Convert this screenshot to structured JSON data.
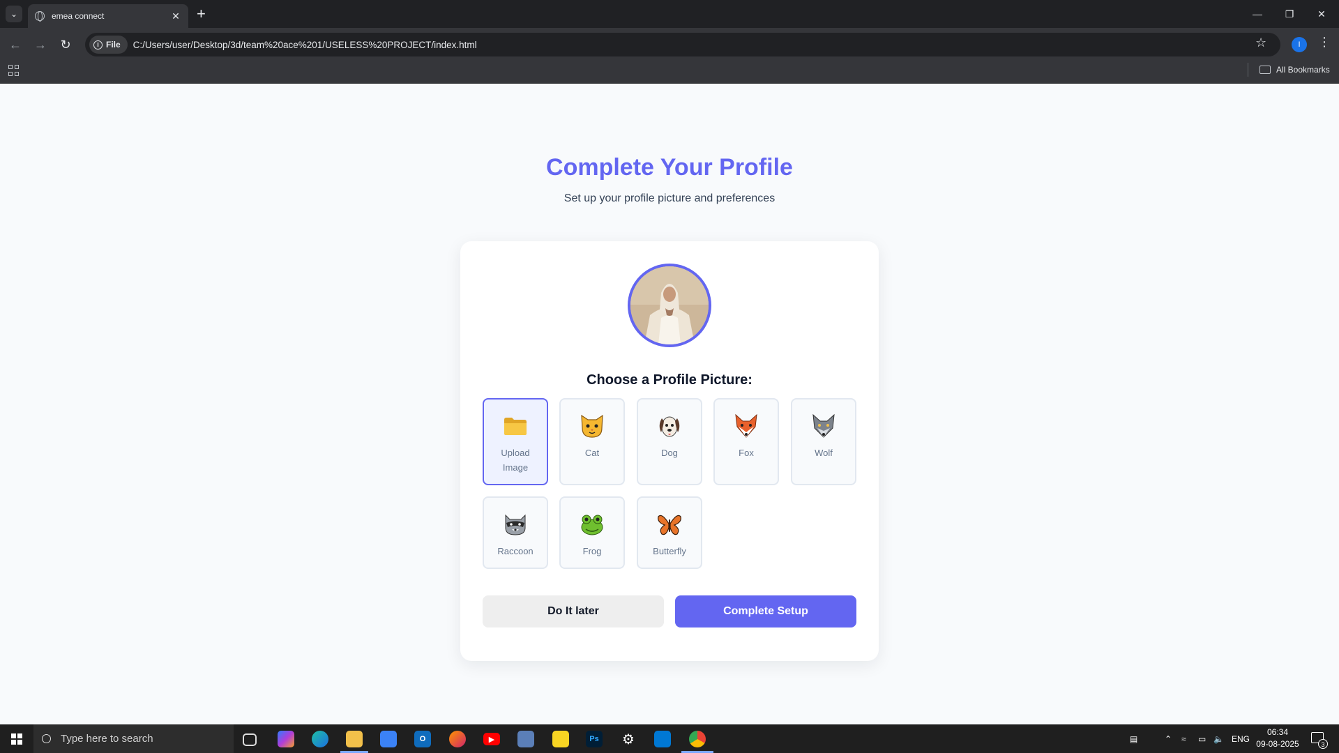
{
  "browser": {
    "tab_title": "emea connect",
    "address_chip": "File",
    "url": "C:/Users/user/Desktop/3d/team%20ace%201/USELESS%20PROJECT/index.html",
    "all_bookmarks": "All Bookmarks",
    "profile_initial": "I"
  },
  "page": {
    "title": "Complete Your Profile",
    "subtitle": "Set up your profile picture and preferences",
    "choose_label": "Choose a Profile Picture:",
    "options": [
      {
        "label": "Upload Image",
        "icon": "folder-icon",
        "selected": true
      },
      {
        "label": "Cat",
        "icon": "cat-icon",
        "selected": false
      },
      {
        "label": "Dog",
        "icon": "dog-icon",
        "selected": false
      },
      {
        "label": "Fox",
        "icon": "fox-icon",
        "selected": false
      },
      {
        "label": "Wolf",
        "icon": "wolf-icon",
        "selected": false
      },
      {
        "label": "Raccoon",
        "icon": "raccoon-icon",
        "selected": false
      },
      {
        "label": "Frog",
        "icon": "frog-icon",
        "selected": false
      },
      {
        "label": "Butterfly",
        "icon": "butterfly-icon",
        "selected": false
      }
    ],
    "later_label": "Do It later",
    "complete_label": "Complete Setup",
    "accent_color": "#6366f1"
  },
  "taskbar": {
    "search_placeholder": "Type here to search",
    "language": "ENG",
    "time": "06:34",
    "date": "09-08-2025",
    "notification_count": "3"
  }
}
